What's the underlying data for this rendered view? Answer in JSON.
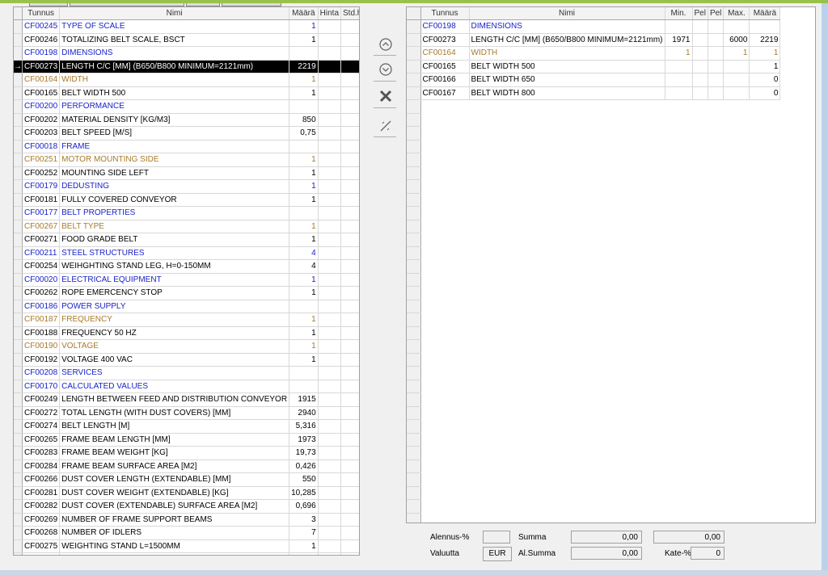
{
  "left_grid": {
    "headers": {
      "code": "Tunnus",
      "name": "Nimi",
      "qty": "Määrä",
      "price": "Hinta",
      "std_price": "Std.hinta"
    },
    "rows": [
      {
        "type": "group",
        "code": "CF00245",
        "name": "TYPE OF SCALE",
        "qty": "1"
      },
      {
        "type": "option",
        "code": "CF00246",
        "name": "TOTALIZING BELT SCALE, BSCT",
        "qty": "1"
      },
      {
        "type": "group",
        "code": "CF00198",
        "name": "DIMENSIONS",
        "qty": ""
      },
      {
        "type": "selected",
        "code": "CF00273",
        "name": "LENGTH C/C [MM] (B650/B800 MINIMUM=2121mm)",
        "qty": "2219",
        "marker": "→"
      },
      {
        "type": "feature",
        "code": "CF00164",
        "name": "WIDTH",
        "qty": "1"
      },
      {
        "type": "option",
        "code": "CF00165",
        "name": "BELT WIDTH 500",
        "qty": "1"
      },
      {
        "type": "group",
        "code": "CF00200",
        "name": "PERFORMANCE",
        "qty": ""
      },
      {
        "type": "option",
        "code": "CF00202",
        "name": "MATERIAL DENSITY [KG/M3]",
        "qty": "850"
      },
      {
        "type": "option",
        "code": "CF00203",
        "name": "BELT SPEED [M/S]",
        "qty": "0,75"
      },
      {
        "type": "group",
        "code": "CF00018",
        "name": "FRAME",
        "qty": ""
      },
      {
        "type": "feature",
        "code": "CF00251",
        "name": "MOTOR MOUNTING SIDE",
        "qty": "1"
      },
      {
        "type": "option",
        "code": "CF00252",
        "name": "MOUNTING SIDE LEFT",
        "qty": "1"
      },
      {
        "type": "group",
        "code": "CF00179",
        "name": "DEDUSTING",
        "qty": "1"
      },
      {
        "type": "option",
        "code": "CF00181",
        "name": "FULLY COVERED CONVEYOR",
        "qty": "1"
      },
      {
        "type": "group",
        "code": "CF00177",
        "name": "BELT PROPERTIES",
        "qty": ""
      },
      {
        "type": "feature",
        "code": "CF00267",
        "name": "BELT TYPE",
        "qty": "1"
      },
      {
        "type": "option",
        "code": "CF00271",
        "name": "FOOD GRADE BELT",
        "qty": "1"
      },
      {
        "type": "group",
        "code": "CF00211",
        "name": "STEEL STRUCTURES",
        "qty": "4"
      },
      {
        "type": "option",
        "code": "CF00254",
        "name": "WEIHGHTING STAND LEG, H=0-150MM",
        "qty": "4"
      },
      {
        "type": "group",
        "code": "CF00020",
        "name": "ELECTRICAL EQUIPMENT",
        "qty": "1"
      },
      {
        "type": "option",
        "code": "CF00262",
        "name": "ROPE EMERCENCY STOP",
        "qty": "1"
      },
      {
        "type": "group",
        "code": "CF00186",
        "name": "POWER SUPPLY",
        "qty": ""
      },
      {
        "type": "feature",
        "code": "CF00187",
        "name": "FREQUENCY",
        "qty": "1"
      },
      {
        "type": "option",
        "code": "CF00188",
        "name": "FREQUENCY 50 HZ",
        "qty": "1"
      },
      {
        "type": "feature",
        "code": "CF00190",
        "name": "VOLTAGE",
        "qty": "1"
      },
      {
        "type": "option",
        "code": "CF00192",
        "name": "VOLTAGE 400 VAC",
        "qty": "1"
      },
      {
        "type": "group",
        "code": "CF00208",
        "name": "SERVICES",
        "qty": ""
      },
      {
        "type": "group",
        "code": "CF00170",
        "name": "CALCULATED VALUES",
        "qty": ""
      },
      {
        "type": "option",
        "code": "CF00249",
        "name": "LENGTH BETWEEN FEED AND DISTRIBUTION CONVEYOR",
        "qty": "1915"
      },
      {
        "type": "option",
        "code": "CF00272",
        "name": "TOTAL LENGTH (WITH DUST COVERS) [MM]",
        "qty": "2940"
      },
      {
        "type": "option",
        "code": "CF00274",
        "name": "BELT LENGTH [M]",
        "qty": "5,316"
      },
      {
        "type": "option",
        "code": "CF00265",
        "name": "FRAME BEAM LENGTH [MM]",
        "qty": "1973"
      },
      {
        "type": "option",
        "code": "CF00283",
        "name": "FRAME BEAM WEIGHT [KG]",
        "qty": "19,73"
      },
      {
        "type": "option",
        "code": "CF00284",
        "name": "FRAME BEAM SURFACE AREA [M2]",
        "qty": "0,426"
      },
      {
        "type": "option",
        "code": "CF00266",
        "name": "DUST COVER LENGTH (EXTENDABLE) [MM]",
        "qty": "550"
      },
      {
        "type": "option",
        "code": "CF00281",
        "name": "DUST COVER WEIGHT (EXTENDABLE) [KG]",
        "qty": "10,285"
      },
      {
        "type": "option",
        "code": "CF00282",
        "name": "DUST COVER (EXTENDABLE) SURFACE AREA [M2]",
        "qty": "0,696"
      },
      {
        "type": "option",
        "code": "CF00269",
        "name": "NUMBER OF FRAME SUPPORT BEAMS",
        "qty": "3"
      },
      {
        "type": "option",
        "code": "CF00268",
        "name": "NUMBER OF IDLERS",
        "qty": "7"
      },
      {
        "type": "option",
        "code": "CF00275",
        "name": "WEIGHTING STAND L=1500MM",
        "qty": "1"
      }
    ]
  },
  "right_grid": {
    "headers": {
      "code": "Tunnus",
      "name": "Nimi",
      "min": "Min.",
      "p1": "Pel",
      "p2": "Pel",
      "max": "Max.",
      "qty": "Määrä"
    },
    "rows": [
      {
        "type": "group",
        "code": "CF00198",
        "name": "DIMENSIONS",
        "min": "",
        "max": "",
        "qty": ""
      },
      {
        "type": "option",
        "code": "CF00273",
        "name": "LENGTH C/C [MM] (B650/B800 MINIMUM=2121mm)",
        "min": "1971",
        "max": "6000",
        "qty": "2219"
      },
      {
        "type": "feature",
        "code": "CF00164",
        "name": "WIDTH",
        "min": "1",
        "max": "1",
        "qty": "1"
      },
      {
        "type": "option",
        "code": "CF00165",
        "name": "BELT WIDTH 500",
        "min": "",
        "max": "",
        "qty": "1"
      },
      {
        "type": "option",
        "code": "CF00166",
        "name": "BELT WIDTH 650",
        "min": "",
        "max": "",
        "qty": "0"
      },
      {
        "type": "option",
        "code": "CF00167",
        "name": "BELT WIDTH 800",
        "min": "",
        "max": "",
        "qty": "0"
      }
    ]
  },
  "footer": {
    "discount_label": "Alennus-%",
    "discount_value": "",
    "sum_label": "Summa",
    "sum_value": "0,00",
    "sum_value2": "0,00",
    "currency_label": "Valuutta",
    "currency_value": "EUR",
    "al_sum_label": "Al.Summa",
    "al_sum_value": "0,00",
    "margin_label": "Kate-%",
    "margin_value": "0"
  },
  "icons": [
    "circle-up-icon",
    "circle-down-icon",
    "delete-x-icon",
    "wand-icon"
  ],
  "colors": {
    "group": "#1a22c8",
    "feature": "#a87a2a",
    "accent": "#99c24a"
  }
}
